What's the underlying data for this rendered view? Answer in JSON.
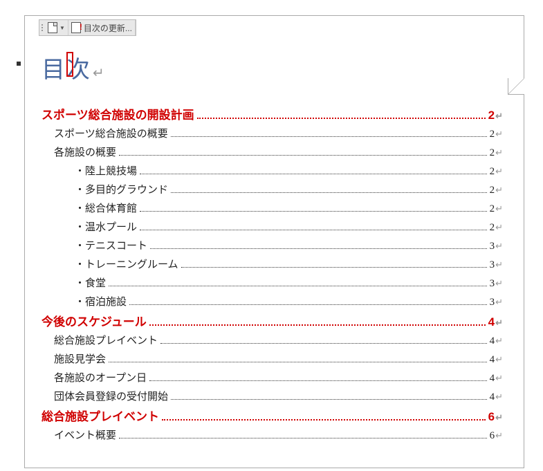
{
  "toolbar": {
    "update_label": "目次の更新...",
    "doc_dropdown_name": "toc-style-dropdown"
  },
  "title": "目次",
  "title_mark": "↵",
  "eol_mark": "↵",
  "bullet": "・",
  "toc": [
    {
      "level": 1,
      "text": "スポーツ総合施設の開設計画",
      "page": "2"
    },
    {
      "level": 2,
      "text": "スポーツ総合施設の概要",
      "page": "2"
    },
    {
      "level": 2,
      "text": "各施設の概要",
      "page": "2"
    },
    {
      "level": 3,
      "text": "陸上競技場",
      "page": "2"
    },
    {
      "level": 3,
      "text": "多目的グラウンド",
      "page": "2"
    },
    {
      "level": 3,
      "text": "総合体育館",
      "page": "2"
    },
    {
      "level": 3,
      "text": "温水プール",
      "page": "2"
    },
    {
      "level": 3,
      "text": "テニスコート",
      "page": "3"
    },
    {
      "level": 3,
      "text": "トレーニングルーム",
      "page": "3"
    },
    {
      "level": 3,
      "text": "食堂",
      "page": "3"
    },
    {
      "level": 3,
      "text": "宿泊施設",
      "page": "3"
    },
    {
      "level": 1,
      "text": "今後のスケジュール",
      "page": "4"
    },
    {
      "level": 2,
      "text": "総合施設プレイベント",
      "page": "4"
    },
    {
      "level": 2,
      "text": "施設見学会",
      "page": "4"
    },
    {
      "level": 2,
      "text": "各施設のオープン日",
      "page": "4"
    },
    {
      "level": 2,
      "text": "団体会員登録の受付開始",
      "page": "4"
    },
    {
      "level": 1,
      "text": "総合施設プレイベント",
      "page": "6"
    },
    {
      "level": 2,
      "text": "イベント概要",
      "page": "6"
    }
  ]
}
